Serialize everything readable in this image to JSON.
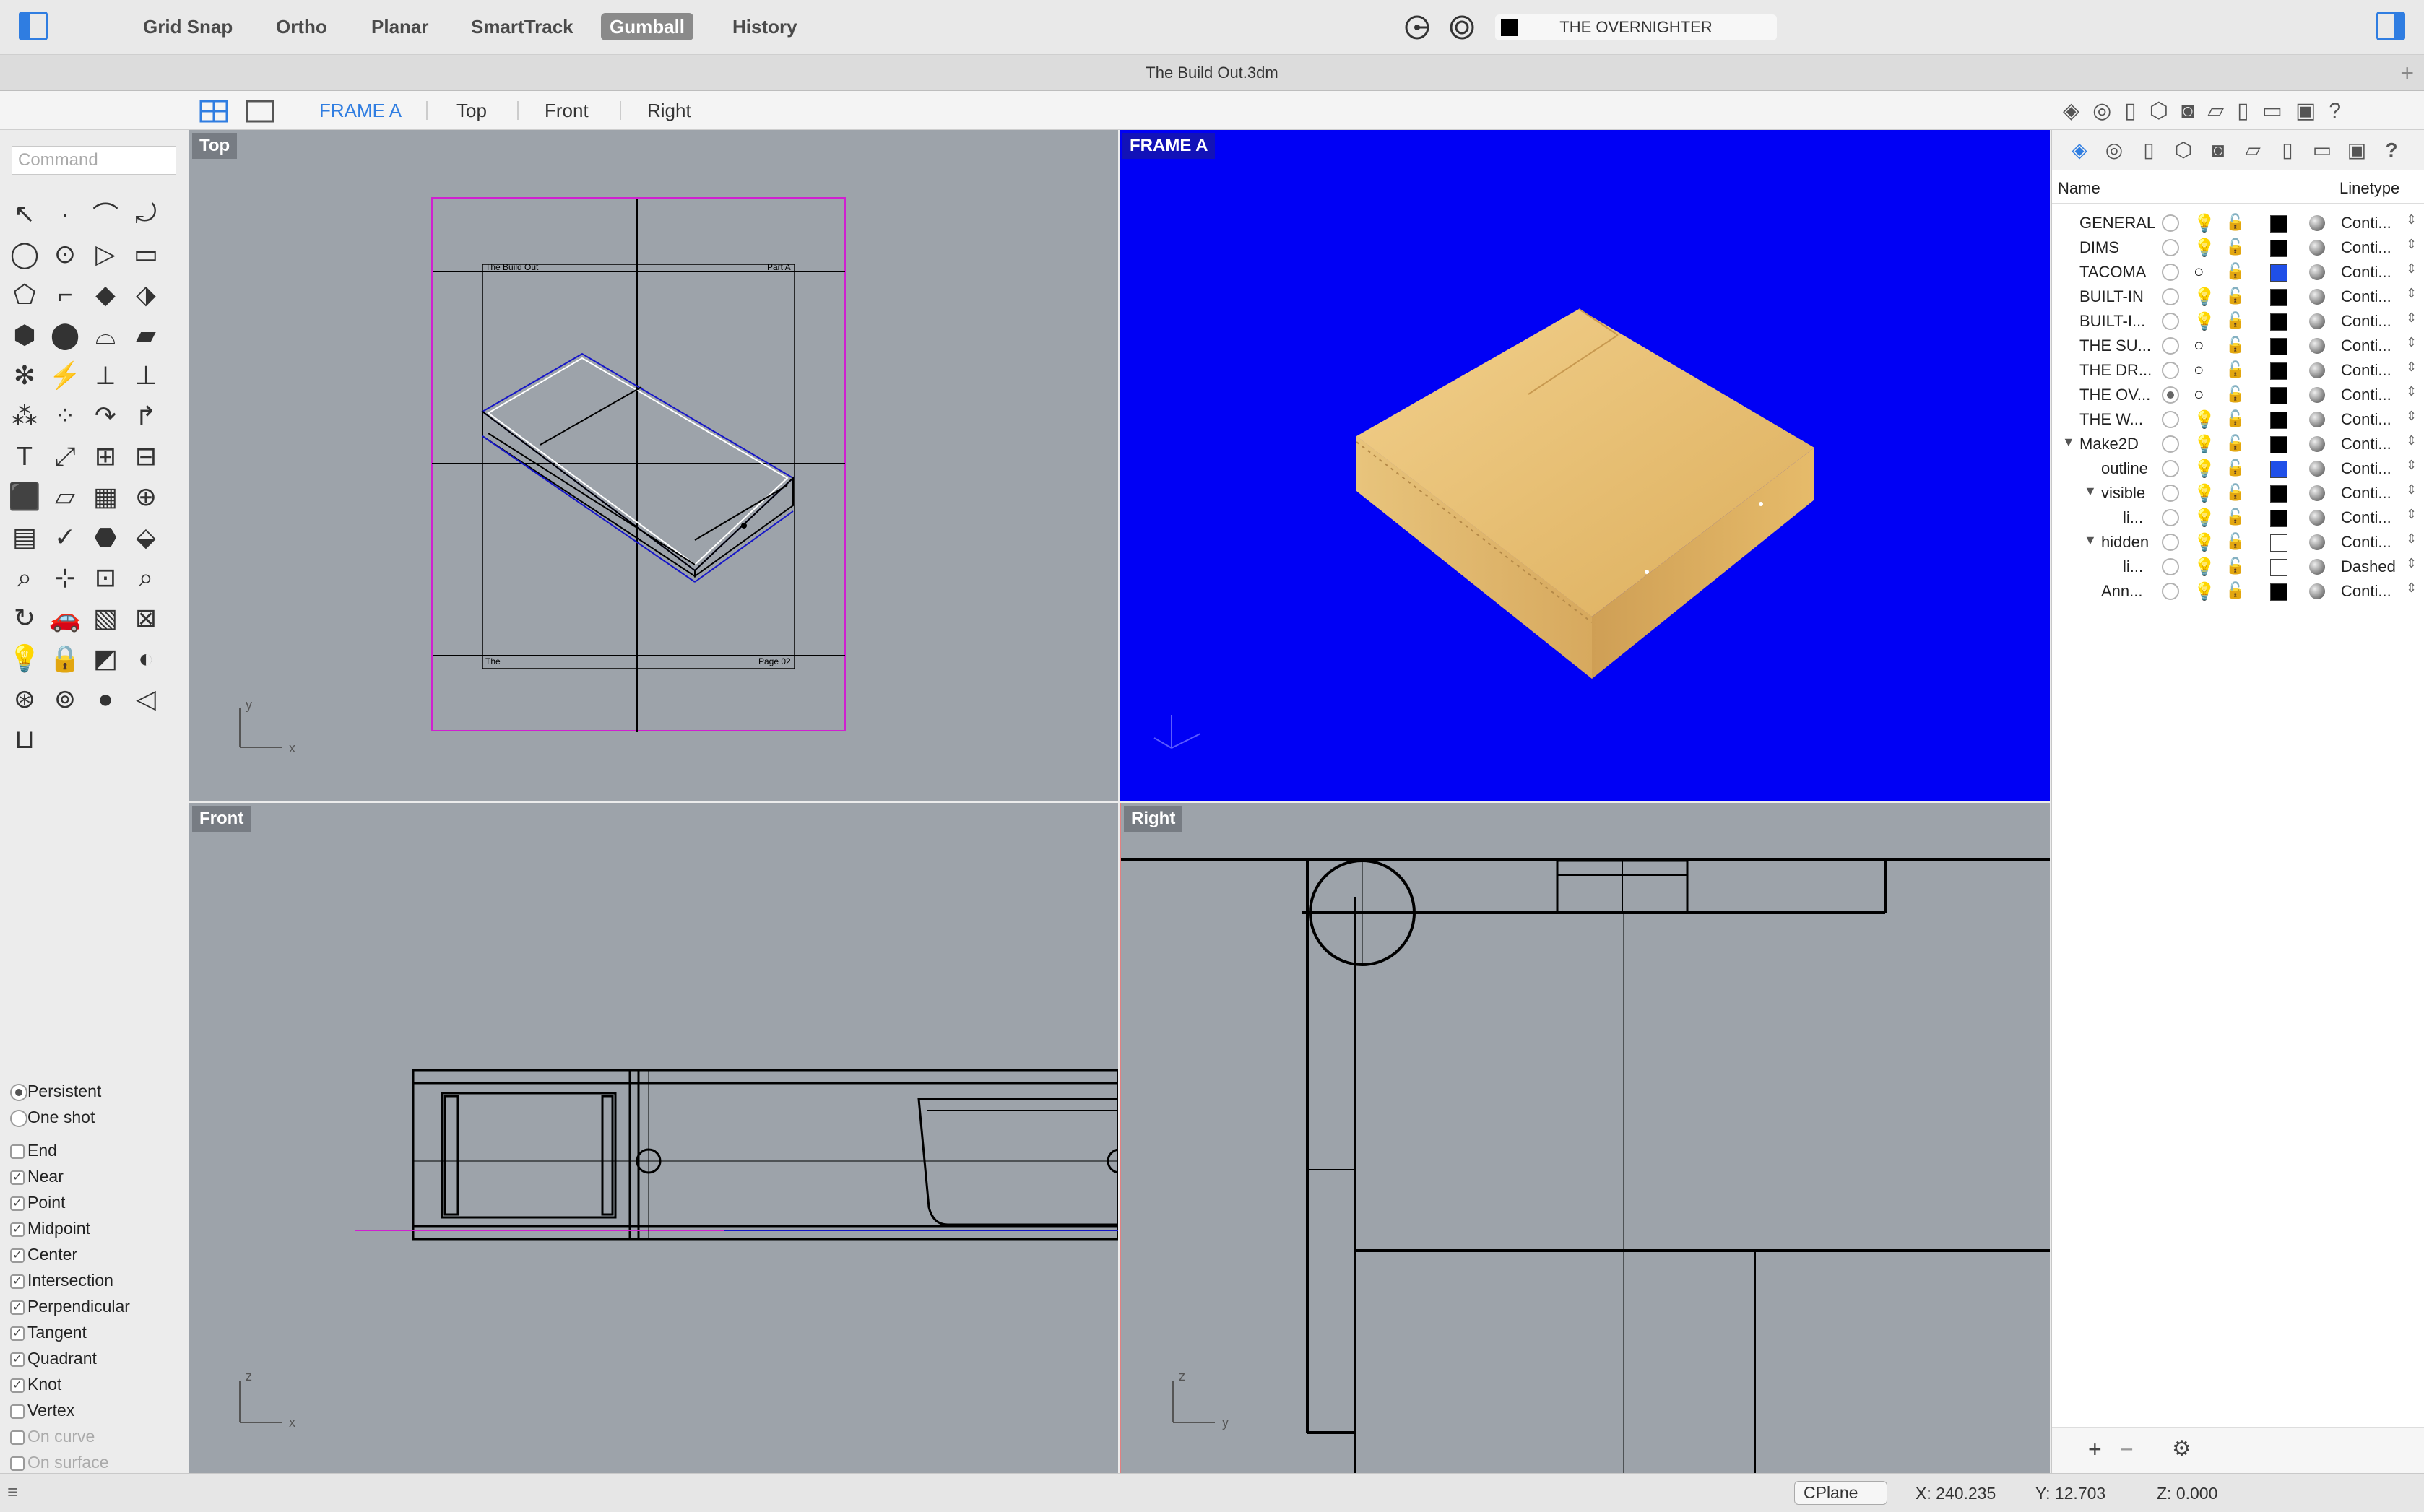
{
  "toolbar": {
    "items": [
      "Grid Snap",
      "Ortho",
      "Planar",
      "SmartTrack",
      "Gumball",
      "History"
    ],
    "current_layer": "THE OVERNIGHTER"
  },
  "window": {
    "title": "The Build Out.3dm"
  },
  "viewport_tabs": [
    "FRAME A",
    "Top",
    "Front",
    "Right"
  ],
  "command": {
    "placeholder": "Command"
  },
  "viewports": {
    "top": {
      "title": "Top",
      "text_title": "The Build Out",
      "text_part": "Part A",
      "text_the": "The",
      "text_page": "Page 02"
    },
    "frame": {
      "title": "FRAME A"
    },
    "front": {
      "title": "Front"
    },
    "right": {
      "title": "Right"
    },
    "axis_x": "x",
    "axis_y": "y",
    "axis_z": "z"
  },
  "osnap": {
    "mode_persistent": "Persistent",
    "mode_oneshot": "One shot",
    "items": [
      {
        "label": "End",
        "checked": false
      },
      {
        "label": "Near",
        "checked": true
      },
      {
        "label": "Point",
        "checked": true
      },
      {
        "label": "Midpoint",
        "checked": true
      },
      {
        "label": "Center",
        "checked": true
      },
      {
        "label": "Intersection",
        "checked": true
      },
      {
        "label": "Perpendicular",
        "checked": true
      },
      {
        "label": "Tangent",
        "checked": true
      },
      {
        "label": "Quadrant",
        "checked": true
      },
      {
        "label": "Knot",
        "checked": true
      },
      {
        "label": "Vertex",
        "checked": false
      },
      {
        "label": "On curve",
        "checked": false
      },
      {
        "label": "On surface",
        "checked": false
      }
    ]
  },
  "layers": {
    "col_name": "Name",
    "col_linetype": "Linetype",
    "rows": [
      {
        "name": "GENERAL",
        "color": "#000000",
        "linetype": "Conti...",
        "indent": 0,
        "current": false,
        "bulb": "💡"
      },
      {
        "name": "DIMS",
        "color": "#000000",
        "linetype": "Conti...",
        "indent": 0,
        "current": false,
        "bulb": "💡"
      },
      {
        "name": "TACOMA",
        "color": "#1f4fe8",
        "linetype": "Conti...",
        "indent": 0,
        "current": false,
        "bulb": "○"
      },
      {
        "name": "BUILT-IN",
        "color": "#000000",
        "linetype": "Conti...",
        "indent": 0,
        "current": false,
        "bulb": "💡"
      },
      {
        "name": "BUILT-I...",
        "color": "#000000",
        "linetype": "Conti...",
        "indent": 0,
        "current": false,
        "bulb": "💡"
      },
      {
        "name": "THE SU...",
        "color": "#000000",
        "linetype": "Conti...",
        "indent": 0,
        "current": false,
        "bulb": "○"
      },
      {
        "name": "THE DR...",
        "color": "#000000",
        "linetype": "Conti...",
        "indent": 0,
        "current": false,
        "bulb": "○"
      },
      {
        "name": "THE OV...",
        "color": "#000000",
        "linetype": "Conti...",
        "indent": 0,
        "current": true,
        "bulb": "○"
      },
      {
        "name": "THE W...",
        "color": "#000000",
        "linetype": "Conti...",
        "indent": 0,
        "current": false,
        "bulb": "💡"
      },
      {
        "name": "Make2D",
        "color": "#000000",
        "linetype": "Conti...",
        "indent": 0,
        "current": false,
        "bulb": "💡",
        "expand": "▼"
      },
      {
        "name": "outline",
        "color": "#1f4fe8",
        "linetype": "Conti...",
        "indent": 1,
        "current": false,
        "bulb": "💡"
      },
      {
        "name": "visible",
        "color": "#000000",
        "linetype": "Conti...",
        "indent": 1,
        "current": false,
        "bulb": "💡",
        "expand": "▼"
      },
      {
        "name": "li...",
        "color": "#000000",
        "linetype": "Conti...",
        "indent": 2,
        "current": false,
        "bulb": "💡"
      },
      {
        "name": "hidden",
        "color": "#ffffff",
        "linetype": "Conti...",
        "indent": 1,
        "current": false,
        "bulb": "💡",
        "expand": "▼"
      },
      {
        "name": "li...",
        "color": "#ffffff",
        "linetype": "Dashed",
        "indent": 2,
        "current": false,
        "bulb": "💡"
      },
      {
        "name": "Ann...",
        "color": "#000000",
        "linetype": "Conti...",
        "indent": 1,
        "current": false,
        "bulb": "💡"
      }
    ],
    "add": "+",
    "remove": "−",
    "gear": "⚙"
  },
  "status": {
    "cplane": "CPlane",
    "x": "X: 240.235",
    "y": "Y: 12.703",
    "z": "Z: 0.000"
  },
  "colors": {
    "accent": "#2f7de1",
    "viewport_bg": "#9da3aa",
    "frame_bg": "#0000f5",
    "wood": "#e3b96a"
  }
}
